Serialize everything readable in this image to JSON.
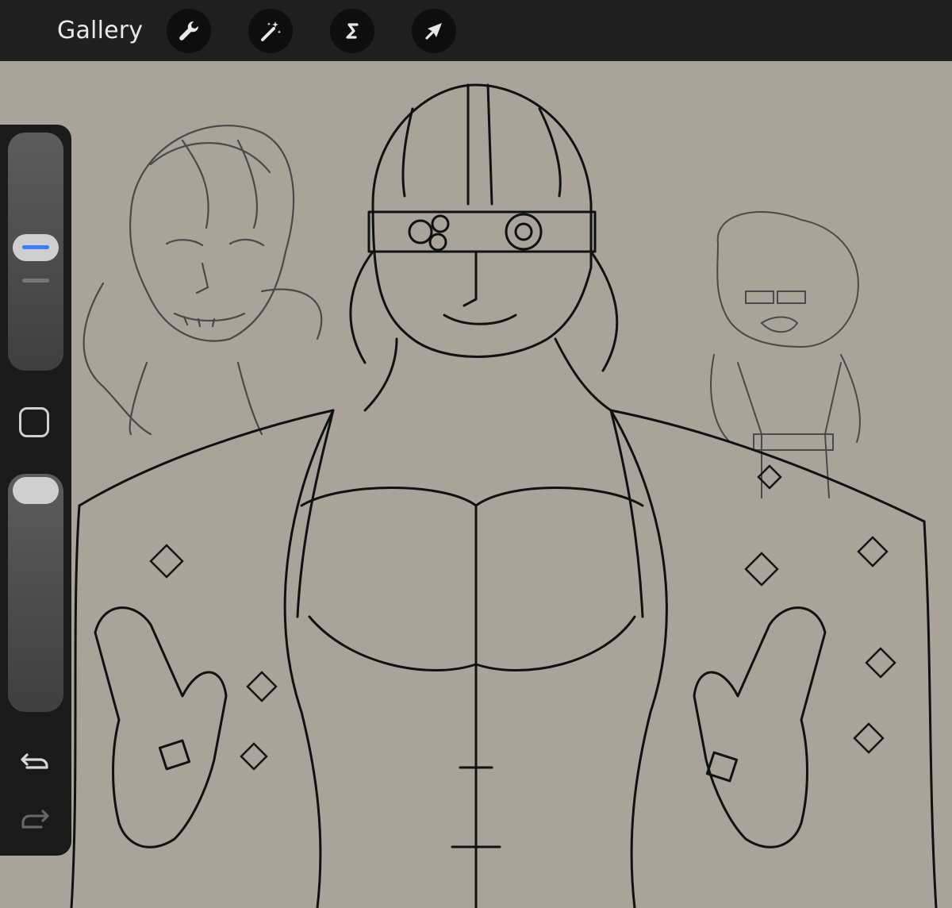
{
  "app": {
    "gallery_label": "Gallery"
  },
  "toolbar": {
    "tools": [
      {
        "name": "actions",
        "icon": "wrench-icon"
      },
      {
        "name": "adjustments",
        "icon": "magic-wand-icon"
      },
      {
        "name": "selection",
        "icon": "selection-s-icon"
      },
      {
        "name": "transform",
        "icon": "arrow-cursor-icon"
      }
    ]
  },
  "sidebar": {
    "brush_size_slider": {
      "level": 0.46
    },
    "modify_button": {
      "icon": "square-icon"
    },
    "opacity_slider": {
      "level": 1.0
    },
    "undo": {
      "icon": "undo-arrow-icon"
    },
    "redo": {
      "icon": "redo-arrow-icon"
    }
  },
  "colors": {
    "canvas_background": "#a9a39a",
    "toolbar_background": "#1f1f1f",
    "slider_accent": "#3c7cff",
    "ink": "#111111"
  }
}
